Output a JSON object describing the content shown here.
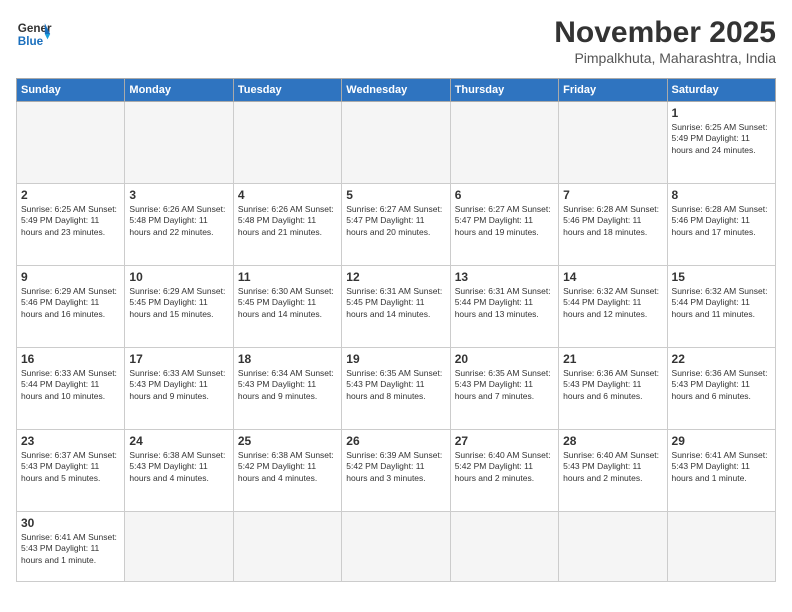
{
  "header": {
    "logo_line1": "General",
    "logo_line2": "Blue",
    "month": "November 2025",
    "location": "Pimpalkhuta, Maharashtra, India"
  },
  "weekdays": [
    "Sunday",
    "Monday",
    "Tuesday",
    "Wednesday",
    "Thursday",
    "Friday",
    "Saturday"
  ],
  "weeks": [
    [
      {
        "day": "",
        "info": ""
      },
      {
        "day": "",
        "info": ""
      },
      {
        "day": "",
        "info": ""
      },
      {
        "day": "",
        "info": ""
      },
      {
        "day": "",
        "info": ""
      },
      {
        "day": "",
        "info": ""
      },
      {
        "day": "1",
        "info": "Sunrise: 6:25 AM\nSunset: 5:49 PM\nDaylight: 11 hours\nand 24 minutes."
      }
    ],
    [
      {
        "day": "2",
        "info": "Sunrise: 6:25 AM\nSunset: 5:49 PM\nDaylight: 11 hours\nand 23 minutes."
      },
      {
        "day": "3",
        "info": "Sunrise: 6:26 AM\nSunset: 5:48 PM\nDaylight: 11 hours\nand 22 minutes."
      },
      {
        "day": "4",
        "info": "Sunrise: 6:26 AM\nSunset: 5:48 PM\nDaylight: 11 hours\nand 21 minutes."
      },
      {
        "day": "5",
        "info": "Sunrise: 6:27 AM\nSunset: 5:47 PM\nDaylight: 11 hours\nand 20 minutes."
      },
      {
        "day": "6",
        "info": "Sunrise: 6:27 AM\nSunset: 5:47 PM\nDaylight: 11 hours\nand 19 minutes."
      },
      {
        "day": "7",
        "info": "Sunrise: 6:28 AM\nSunset: 5:46 PM\nDaylight: 11 hours\nand 18 minutes."
      },
      {
        "day": "8",
        "info": "Sunrise: 6:28 AM\nSunset: 5:46 PM\nDaylight: 11 hours\nand 17 minutes."
      }
    ],
    [
      {
        "day": "9",
        "info": "Sunrise: 6:29 AM\nSunset: 5:46 PM\nDaylight: 11 hours\nand 16 minutes."
      },
      {
        "day": "10",
        "info": "Sunrise: 6:29 AM\nSunset: 5:45 PM\nDaylight: 11 hours\nand 15 minutes."
      },
      {
        "day": "11",
        "info": "Sunrise: 6:30 AM\nSunset: 5:45 PM\nDaylight: 11 hours\nand 14 minutes."
      },
      {
        "day": "12",
        "info": "Sunrise: 6:31 AM\nSunset: 5:45 PM\nDaylight: 11 hours\nand 14 minutes."
      },
      {
        "day": "13",
        "info": "Sunrise: 6:31 AM\nSunset: 5:44 PM\nDaylight: 11 hours\nand 13 minutes."
      },
      {
        "day": "14",
        "info": "Sunrise: 6:32 AM\nSunset: 5:44 PM\nDaylight: 11 hours\nand 12 minutes."
      },
      {
        "day": "15",
        "info": "Sunrise: 6:32 AM\nSunset: 5:44 PM\nDaylight: 11 hours\nand 11 minutes."
      }
    ],
    [
      {
        "day": "16",
        "info": "Sunrise: 6:33 AM\nSunset: 5:44 PM\nDaylight: 11 hours\nand 10 minutes."
      },
      {
        "day": "17",
        "info": "Sunrise: 6:33 AM\nSunset: 5:43 PM\nDaylight: 11 hours\nand 9 minutes."
      },
      {
        "day": "18",
        "info": "Sunrise: 6:34 AM\nSunset: 5:43 PM\nDaylight: 11 hours\nand 9 minutes."
      },
      {
        "day": "19",
        "info": "Sunrise: 6:35 AM\nSunset: 5:43 PM\nDaylight: 11 hours\nand 8 minutes."
      },
      {
        "day": "20",
        "info": "Sunrise: 6:35 AM\nSunset: 5:43 PM\nDaylight: 11 hours\nand 7 minutes."
      },
      {
        "day": "21",
        "info": "Sunrise: 6:36 AM\nSunset: 5:43 PM\nDaylight: 11 hours\nand 6 minutes."
      },
      {
        "day": "22",
        "info": "Sunrise: 6:36 AM\nSunset: 5:43 PM\nDaylight: 11 hours\nand 6 minutes."
      }
    ],
    [
      {
        "day": "23",
        "info": "Sunrise: 6:37 AM\nSunset: 5:43 PM\nDaylight: 11 hours\nand 5 minutes."
      },
      {
        "day": "24",
        "info": "Sunrise: 6:38 AM\nSunset: 5:43 PM\nDaylight: 11 hours\nand 4 minutes."
      },
      {
        "day": "25",
        "info": "Sunrise: 6:38 AM\nSunset: 5:42 PM\nDaylight: 11 hours\nand 4 minutes."
      },
      {
        "day": "26",
        "info": "Sunrise: 6:39 AM\nSunset: 5:42 PM\nDaylight: 11 hours\nand 3 minutes."
      },
      {
        "day": "27",
        "info": "Sunrise: 6:40 AM\nSunset: 5:42 PM\nDaylight: 11 hours\nand 2 minutes."
      },
      {
        "day": "28",
        "info": "Sunrise: 6:40 AM\nSunset: 5:43 PM\nDaylight: 11 hours\nand 2 minutes."
      },
      {
        "day": "29",
        "info": "Sunrise: 6:41 AM\nSunset: 5:43 PM\nDaylight: 11 hours\nand 1 minute."
      }
    ],
    [
      {
        "day": "30",
        "info": "Sunrise: 6:41 AM\nSunset: 5:43 PM\nDaylight: 11 hours\nand 1 minute."
      },
      {
        "day": "",
        "info": ""
      },
      {
        "day": "",
        "info": ""
      },
      {
        "day": "",
        "info": ""
      },
      {
        "day": "",
        "info": ""
      },
      {
        "day": "",
        "info": ""
      },
      {
        "day": "",
        "info": ""
      }
    ]
  ]
}
